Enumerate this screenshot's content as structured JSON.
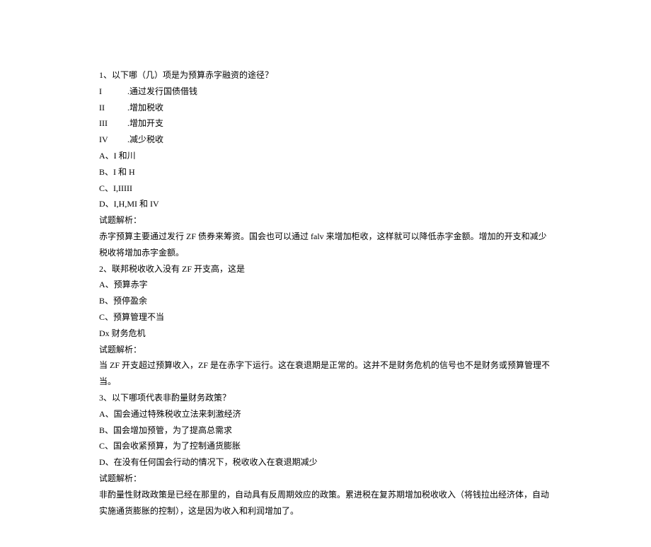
{
  "q1": {
    "stem": "1、以下哪（几）项是为预算赤字融资的途径？",
    "I": "I",
    "I_text": ".通过发行国债借钱",
    "II": "II",
    "II_text": ".增加税收",
    "III": "III",
    "III_text": ".增加开支",
    "IV": "IV",
    "IV_text": ".减少税收",
    "A": "A、I 和川",
    "B": "B、I 和 H",
    "C": "C、I,IIIII",
    "D": "D、I,H,MI 和 IV",
    "analysis_label": "试题解析：",
    "analysis_text": "赤字预算主要通过发行 ZF 债券来筹资。国会也可以通过 falv 来增加柜收，这样就可以降低赤字金额。增加的开支和减少税收将增加赤字金额。"
  },
  "q2": {
    "stem": "2、联邦税收收入没有 ZF 开支高，这是",
    "A": "A、预算赤字",
    "B": "B、预停盈余",
    "C": "C、预算管理不当",
    "D": "Dx 财务危机",
    "analysis_label": "试题解析：",
    "analysis_text": "当 ZF 开支超过预算收入，ZF 是在赤字下运行。这在衰退期是正常的。这并不是财务危机的信号也不是财务或预算管理不当。"
  },
  "q3": {
    "stem": "3、以下哪项代表非酌量财务政策？",
    "A": "A、国会通过特殊税收立法来刺激经济",
    "B": "B、国会增加预管，为了提高总需求",
    "C": "C、国会收紧预算，为了控制通货膨胀",
    "D": "D、在没有任何国会行动的情况下，税收收入在衰退期减少",
    "analysis_label": "试题解析：",
    "analysis_text": "非酌量性财政政策是已经在那里的，自动具有反周期效应的政策。累进税在复苏期增加税收收入（将钱拉出经济体，自动实施通货膨胀的控制），这是因为收入和利润增加了。"
  }
}
